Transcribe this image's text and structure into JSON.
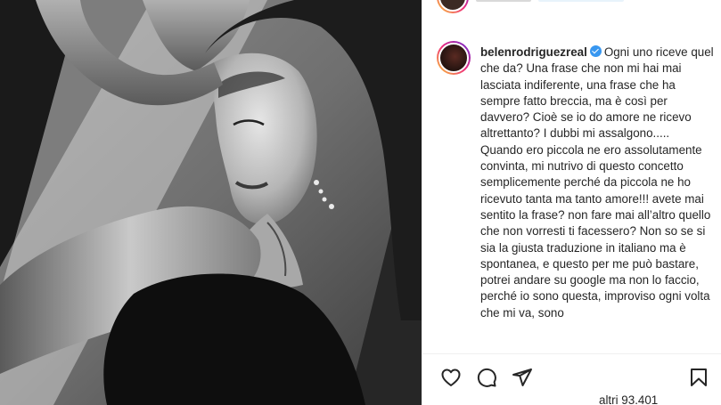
{
  "post": {
    "username": "belenrodriguezreal",
    "caption_paragraphs": [
      "Ogni uno riceve quel che da? Una frase che non mi hai mai lasciata indiferente, una frase che ha sempre fatto breccia, ma è così per davvero? Cioè se io do amore ne ricevo altrettanto? I dubbi mi assalgono.....",
      "Quando ero piccola ne ero assolutamente convinta, mi nutrivo di questo concetto semplicemente perché da piccola ne ho ricevuto tanta ma tanto amore!!! avete mai sentito la frase? non fare mai all’altro quello che non vorresti ti facessero? Non so se si sia la giusta traduzione in italiano ma è spontanea, e questo per me può bastare, potrei andare su google ma non lo faccio, perché io sono questa, improviso ogni volta che mi va, sono"
    ],
    "likes_text": "altri 93.401"
  },
  "icons": {
    "like": "heart-icon",
    "comment": "comment-icon",
    "share": "paper-plane-icon",
    "save": "bookmark-icon",
    "verified": "verified-badge-icon"
  },
  "colors": {
    "text": "#262626",
    "verified": "#3897f0",
    "divider": "#efefef"
  }
}
